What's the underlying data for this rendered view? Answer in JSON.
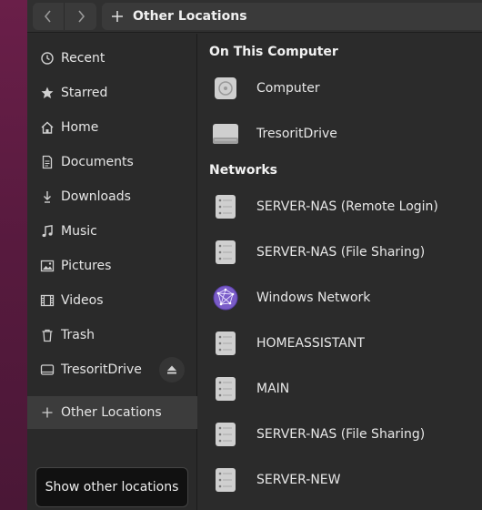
{
  "header": {
    "title": "Other Locations"
  },
  "sidebar": {
    "items": [
      {
        "label": "Recent",
        "icon": "clock-icon"
      },
      {
        "label": "Starred",
        "icon": "star-icon"
      },
      {
        "label": "Home",
        "icon": "home-icon"
      },
      {
        "label": "Documents",
        "icon": "document-icon"
      },
      {
        "label": "Downloads",
        "icon": "download-icon"
      },
      {
        "label": "Music",
        "icon": "music-icon"
      },
      {
        "label": "Pictures",
        "icon": "picture-icon"
      },
      {
        "label": "Videos",
        "icon": "video-icon"
      },
      {
        "label": "Trash",
        "icon": "trash-icon"
      },
      {
        "label": "TresoritDrive",
        "icon": "drive-icon"
      }
    ],
    "other_locations": "Other Locations",
    "tooltip": "Show other locations"
  },
  "main": {
    "computer_section": "On This Computer",
    "computer_items": [
      {
        "label": "Computer",
        "icon": "computer-disc-icon"
      },
      {
        "label": "TresoritDrive",
        "icon": "drive-icon"
      }
    ],
    "network_section": "Networks",
    "network_items": [
      {
        "label": "SERVER-NAS (Remote Login)",
        "icon": "server-icon"
      },
      {
        "label": "SERVER-NAS (File Sharing)",
        "icon": "server-icon"
      },
      {
        "label": "Windows Network",
        "icon": "network-globe-icon"
      },
      {
        "label": "HOMEASSISTANT",
        "icon": "server-icon"
      },
      {
        "label": "MAIN",
        "icon": "server-icon"
      },
      {
        "label": "SERVER-NAS (File Sharing)",
        "icon": "server-icon"
      },
      {
        "label": "SERVER-NEW",
        "icon": "server-icon"
      }
    ]
  },
  "colors": {
    "window_bg": "#2b2b2b",
    "sidebar_bg": "#2a2a2a",
    "active_item": "#3c3c3c",
    "desktop": "#5a1a40",
    "network_globe": "#7a5cc8"
  }
}
